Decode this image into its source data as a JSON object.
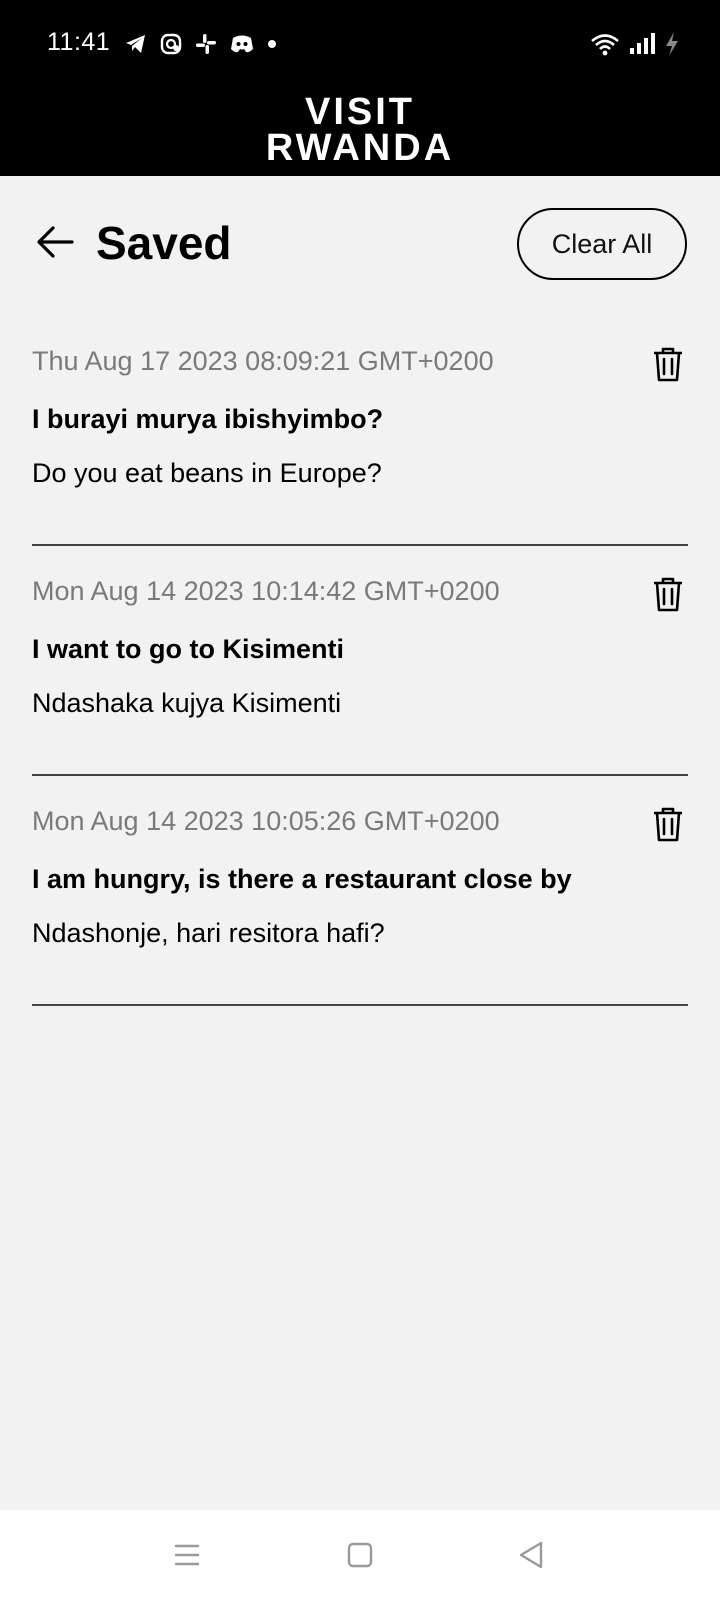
{
  "status_bar": {
    "time": "11:41",
    "left_icons": [
      "telegram-icon",
      "messenger-icon",
      "slack-icon",
      "discord-icon",
      "dot-icon"
    ],
    "right_icons": [
      "wifi-icon",
      "signal-icon",
      "charging-icon"
    ]
  },
  "header": {
    "logo_line1": "VISIT",
    "logo_line2": "RWANDA"
  },
  "titlebar": {
    "back_icon": "arrow-left-icon",
    "title": "Saved",
    "clear_all_label": "Clear All"
  },
  "saved_items": [
    {
      "date": "Thu Aug 17 2023 08:09:21 GMT+0200",
      "source": "I burayi murya ibishyimbo?",
      "translation": "Do you eat beans in Europe?"
    },
    {
      "date": "Mon Aug 14 2023 10:14:42 GMT+0200",
      "source": "I want to go to Kisimenti",
      "translation": "Ndashaka kujya Kisimenti"
    },
    {
      "date": "Mon Aug 14 2023 10:05:26 GMT+0200",
      "source": "I am hungry, is there a restaurant close by",
      "translation": "Ndashonje, hari resitora hafi?"
    }
  ],
  "nav_bar": {
    "icons": [
      "menu-icon",
      "home-square-icon",
      "back-triangle-icon"
    ]
  },
  "colors": {
    "background": "#f2f2f2",
    "header": "#000000",
    "date_text": "#7a7a7a",
    "divider": "#444444"
  }
}
